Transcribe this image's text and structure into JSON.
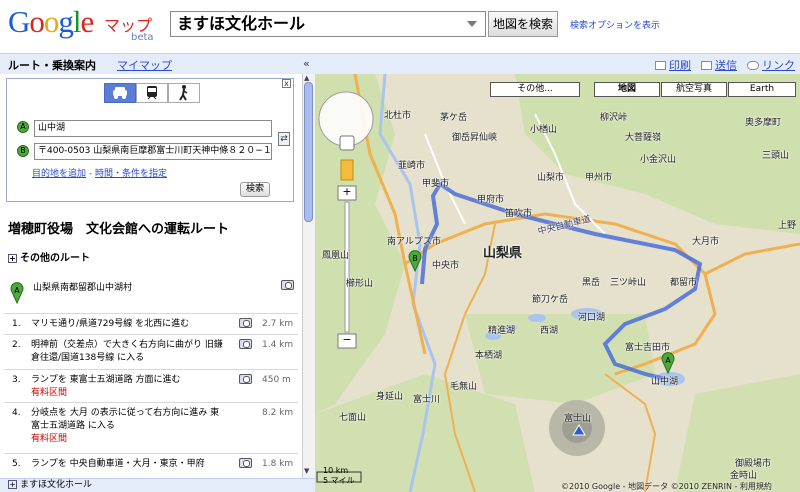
{
  "header": {
    "logo_text": "Google",
    "maps_word": "マップ",
    "beta": "beta",
    "search_value": "ますほ文化ホール",
    "search_button": "地図を検索",
    "search_options": "検索オプションを表示"
  },
  "toolbar": {
    "tab_route": "ルート・乗換案内",
    "tab_mymap": "マイマップ",
    "collapse": "«",
    "print": "印刷",
    "send": "送信",
    "link": "リンク"
  },
  "form": {
    "close": "x",
    "marker_a": "A",
    "marker_b": "B",
    "from": "山中湖",
    "to": "〒400-0503 山梨県南巨摩郡富士川町天神中條８２０−１",
    "swap": "⇄",
    "add_destination": "目的地を追加",
    "separator": " - ",
    "time_conditions": "時間・条件を指定",
    "search_button": "検索"
  },
  "route": {
    "title": "増穂町役場　文化会館への運転ルート",
    "other_routes": "その他のルート",
    "start_marker": "A",
    "start_location": "山梨県南都留郡山中湖村",
    "steps": [
      {
        "num": "1.",
        "text": "マリモ通り/県道729号線 を北西に進む",
        "toll": "",
        "distance": "2.7 km"
      },
      {
        "num": "2.",
        "text": "明神前（交差点）で大きく右方向に曲がり 旧鎌倉往還/国道138号線 に入る",
        "toll": "",
        "distance": "1.4 km"
      },
      {
        "num": "3.",
        "text": "ランプを 東富士五湖道路 方面に進む",
        "toll": "有料区間",
        "distance": "450 m"
      },
      {
        "num": "4.",
        "text": "分岐点を 大月 の表示に従って右方向に進み 東富士五湖道路 に入る",
        "toll": "有料区間",
        "distance": "8.2 km"
      },
      {
        "num": "5.",
        "text": "ランプを 中央自動車道・大月・東京・甲府",
        "toll": "",
        "distance": "1.8 km"
      }
    ]
  },
  "footer": {
    "destination": "ますほ文化ホール"
  },
  "map": {
    "types": {
      "other": "その他...",
      "map": "地図",
      "satellite": "航空写真",
      "earth": "Earth"
    },
    "labels": [
      {
        "text": "北杜市"
      },
      {
        "text": "茅ケ岳"
      },
      {
        "text": "御岳昇仙峡"
      },
      {
        "text": "小楢山"
      },
      {
        "text": "柳沢峠"
      },
      {
        "text": "大菩薩嶺"
      },
      {
        "text": "小金沢山"
      },
      {
        "text": "奥多摩町"
      },
      {
        "text": "三頭山"
      },
      {
        "text": "韮崎市"
      },
      {
        "text": "甲斐市"
      },
      {
        "text": "山梨市"
      },
      {
        "text": "甲州市"
      },
      {
        "text": "甲府市"
      },
      {
        "text": "笛吹市"
      },
      {
        "text": "中央自動車道"
      },
      {
        "text": "大月市"
      },
      {
        "text": "南アルプス市"
      },
      {
        "text": "中央市"
      },
      {
        "text": "鳳凰山"
      },
      {
        "text": "山梨県"
      },
      {
        "text": "黒岳"
      },
      {
        "text": "三ツ峠山"
      },
      {
        "text": "都留市"
      },
      {
        "text": "節刀ケ岳"
      },
      {
        "text": "櫛形山"
      },
      {
        "text": "河口湖"
      },
      {
        "text": "精進湖"
      },
      {
        "text": "西湖"
      },
      {
        "text": "富士吉田市"
      },
      {
        "text": "本栖湖"
      },
      {
        "text": "山中湖"
      },
      {
        "text": "身延山"
      },
      {
        "text": "毛無山"
      },
      {
        "text": "富士川"
      },
      {
        "text": "七面山"
      },
      {
        "text": "富士山"
      },
      {
        "text": "御殿場市"
      },
      {
        "text": "金時山"
      },
      {
        "text": "上野"
      }
    ],
    "route_marker_a": "A",
    "route_marker_b": "B",
    "scale_km": "10 km",
    "scale_mi": "5 マイル",
    "copyright": "©2010 Google - 地図データ ©2010 ZENRIN - 利用規約",
    "colors": {
      "route": "#4a6fd8",
      "highway": "#f0b050",
      "water": "#a9c4ee",
      "green": "#c9dfa5",
      "land": "#e6e1cc"
    }
  }
}
